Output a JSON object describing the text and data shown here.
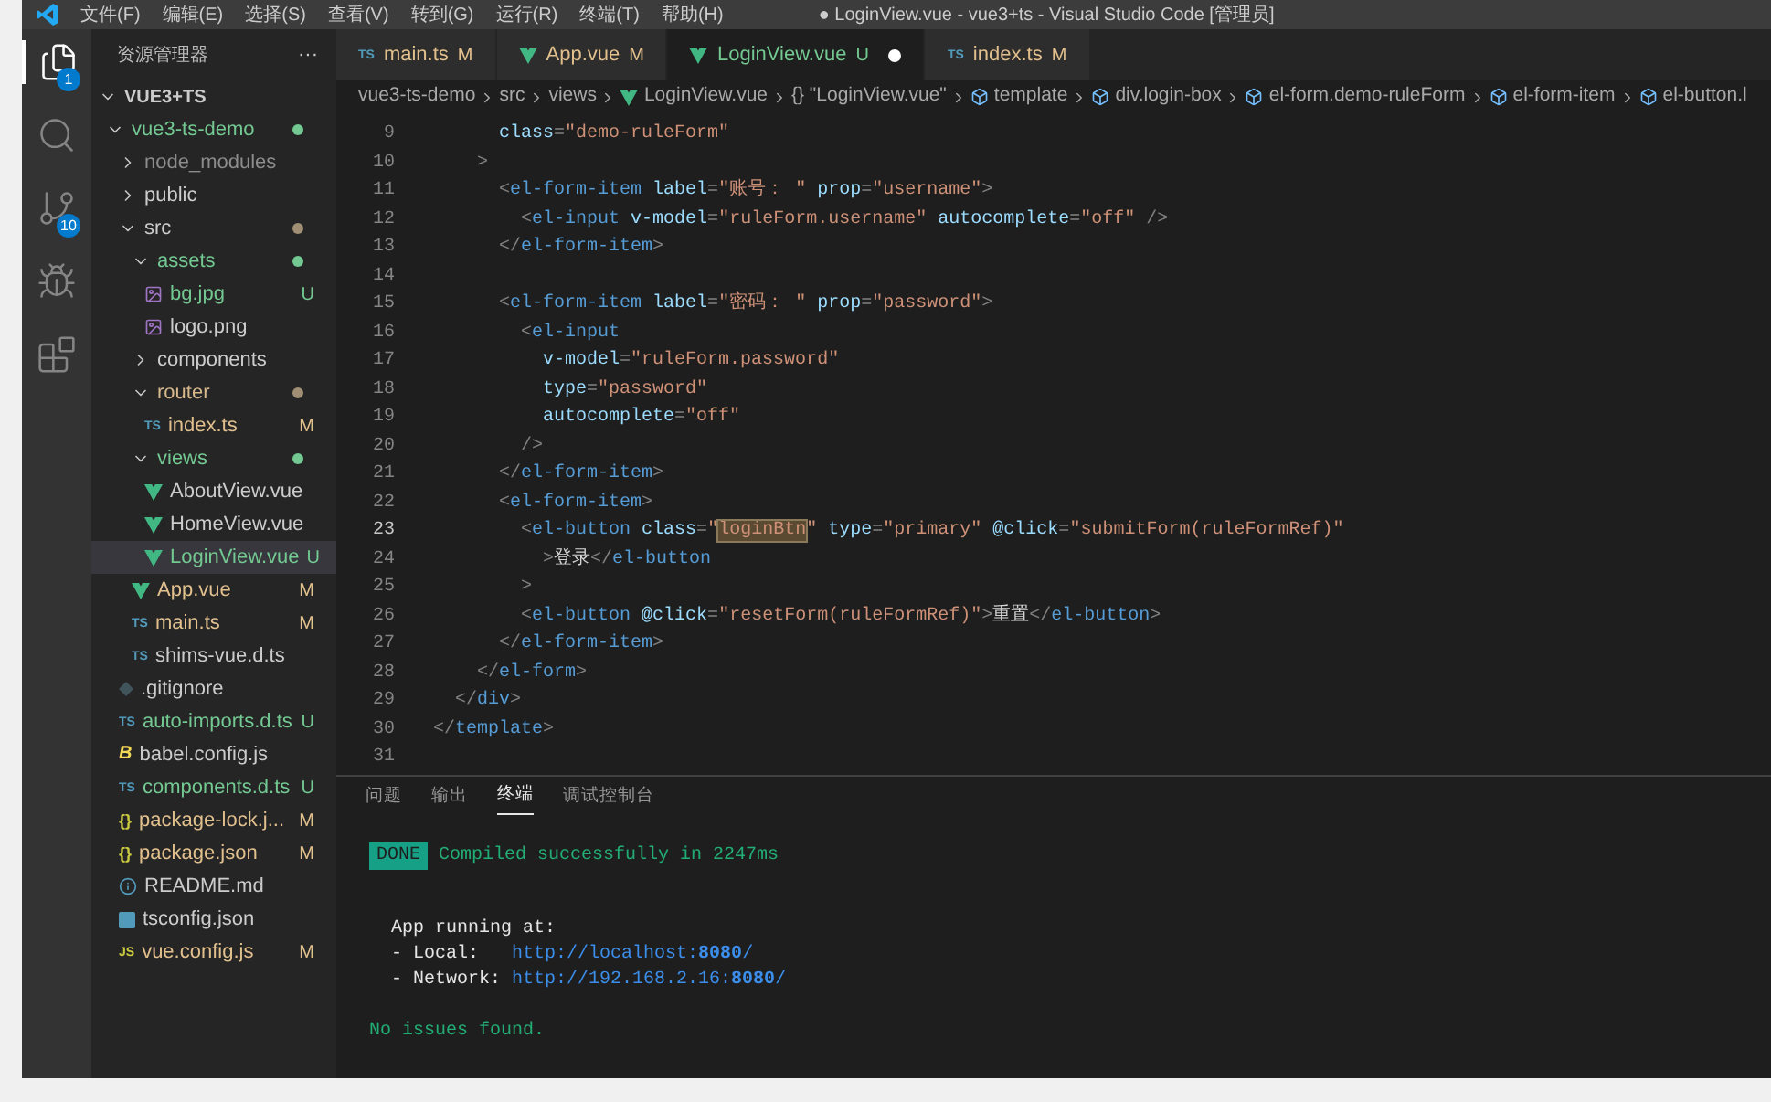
{
  "window": {
    "title": "● LoginView.vue - vue3+ts - Visual Studio Code [管理员]"
  },
  "menu": [
    "文件(F)",
    "编辑(E)",
    "选择(S)",
    "查看(V)",
    "转到(G)",
    "运行(R)",
    "终端(T)",
    "帮助(H)"
  ],
  "activity_bar": [
    {
      "kind": "explorer",
      "selected": true,
      "badge": "1"
    },
    {
      "kind": "search",
      "selected": false
    },
    {
      "kind": "source-control",
      "selected": false,
      "badge": "10"
    },
    {
      "kind": "run",
      "selected": false
    },
    {
      "kind": "extensions",
      "selected": false
    }
  ],
  "sidebar": {
    "title": "资源管理器",
    "more": "···",
    "section": {
      "name": "VUE3+TS",
      "expanded": true,
      "items": [
        {
          "name": "vue3-ts-demo",
          "kind": "folder",
          "expanded": true,
          "color": "#73c991",
          "dot": {
            "color": "#73c991"
          },
          "children": [
            {
              "name": "node_modules",
              "kind": "folder",
              "expanded": false,
              "color": "#8c8c8c"
            },
            {
              "name": "public",
              "kind": "folder",
              "expanded": false,
              "color": "#cccccc"
            },
            {
              "name": "src",
              "kind": "folder",
              "expanded": true,
              "color": "#cccccc",
              "dot": {
                "color": "#a08f73"
              },
              "children": [
                {
                  "name": "assets",
                  "kind": "folder",
                  "expanded": true,
                  "color": "#73c991",
                  "dot": {
                    "color": "#73c991"
                  },
                  "children": [
                    {
                      "name": "bg.jpg",
                      "kind": "image",
                      "color": "#73c991",
                      "badge": "U",
                      "selected": false
                    },
                    {
                      "name": "logo.png",
                      "kind": "image",
                      "color": "#cccccc",
                      "selected": false
                    }
                  ]
                },
                {
                  "name": "components",
                  "kind": "folder",
                  "expanded": false,
                  "color": "#cccccc"
                },
                {
                  "name": "router",
                  "kind": "folder",
                  "expanded": true,
                  "color": "#d7b98c",
                  "dot": {
                    "color": "#a08f73"
                  },
                  "children": [
                    {
                      "name": "index.ts",
                      "kind": "ts",
                      "icon_label": "TS",
                      "color": "#e2c08d",
                      "badge": "M",
                      "selected": false
                    }
                  ]
                },
                {
                  "name": "views",
                  "kind": "folder",
                  "expanded": true,
                  "color": "#73c991",
                  "dot": {
                    "color": "#73c991"
                  },
                  "children": [
                    {
                      "name": "AboutView.vue",
                      "kind": "vue",
                      "color": "#cccccc",
                      "selected": false
                    },
                    {
                      "name": "HomeView.vue",
                      "kind": "vue",
                      "color": "#cccccc",
                      "selected": false
                    },
                    {
                      "name": "LoginView.vue",
                      "kind": "vue",
                      "color": "#73c991",
                      "badge": "U",
                      "selected": true
                    }
                  ]
                },
                {
                  "name": "App.vue",
                  "kind": "vue",
                  "color": "#e2c08d",
                  "badge": "M",
                  "selected": false
                },
                {
                  "name": "main.ts",
                  "kind": "ts",
                  "icon_label": "TS",
                  "color": "#e2c08d",
                  "badge": "M",
                  "selected": false
                },
                {
                  "name": "shims-vue.d.ts",
                  "kind": "ts",
                  "icon_label": "TS",
                  "color": "#cccccc",
                  "selected": false
                }
              ]
            },
            {
              "name": ".gitignore",
              "kind": "git",
              "color": "#cccccc",
              "selected": false
            },
            {
              "name": "auto-imports.d.ts",
              "kind": "ts",
              "icon_label": "TS",
              "color": "#73c991",
              "badge": "U",
              "selected": false
            },
            {
              "name": "babel.config.js",
              "kind": "babel",
              "icon_label": "B",
              "color": "#cccccc",
              "selected": false
            },
            {
              "name": "components.d.ts",
              "kind": "ts",
              "icon_label": "TS",
              "color": "#73c991",
              "badge": "U",
              "selected": false
            },
            {
              "name": "package-lock.j...",
              "kind": "json",
              "icon_label": "{}",
              "color": "#e2c08d",
              "badge": "M",
              "selected": false
            },
            {
              "name": "package.json",
              "kind": "json",
              "icon_label": "{}",
              "color": "#e2c08d",
              "badge": "M",
              "selected": false
            },
            {
              "name": "README.md",
              "kind": "info",
              "color": "#cccccc",
              "selected": false
            },
            {
              "name": "tsconfig.json",
              "kind": "tsconfig",
              "color": "#cccccc",
              "selected": false
            },
            {
              "name": "vue.config.js",
              "kind": "js",
              "icon_label": "JS",
              "color": "#e2c08d",
              "badge": "M",
              "selected": false
            }
          ]
        }
      ]
    }
  },
  "tabs": [
    {
      "label": "main.ts",
      "kind": "ts",
      "icon_label": "TS",
      "color": "#e2c08d",
      "badge": "M",
      "selected": false,
      "dirty": false
    },
    {
      "label": "App.vue",
      "kind": "vue",
      "color": "#e2c08d",
      "badge": "M",
      "selected": false,
      "dirty": false
    },
    {
      "label": "LoginView.vue",
      "kind": "vue",
      "color": "#73c991",
      "badge": "U",
      "selected": true,
      "dirty": true
    },
    {
      "label": "index.ts",
      "kind": "ts",
      "icon_label": "TS",
      "color": "#e2c08d",
      "badge": "M",
      "selected": false,
      "dirty": false
    }
  ],
  "breadcrumbs": [
    {
      "text": "vue3-ts-demo",
      "kind": "folder"
    },
    {
      "text": "src",
      "kind": "folder"
    },
    {
      "text": "views",
      "kind": "folder"
    },
    {
      "text": "LoginView.vue",
      "kind": "vue"
    },
    {
      "text": "{} \"LoginView.vue\"",
      "kind": "symbol"
    },
    {
      "text": "template",
      "kind": "element"
    },
    {
      "text": "div.login-box",
      "kind": "element"
    },
    {
      "text": "el-form.demo-ruleForm",
      "kind": "element"
    },
    {
      "text": "el-form-item",
      "kind": "element"
    },
    {
      "text": "el-button.l",
      "kind": "element"
    }
  ],
  "code": [
    {
      "number": "9",
      "current": false,
      "tokens": [
        {
          "kind": "attr",
          "text": "      class"
        },
        {
          "kind": "punct",
          "text": "="
        },
        {
          "kind": "str",
          "text": "\"demo-ruleForm\""
        }
      ]
    },
    {
      "number": "10",
      "current": false,
      "tokens": [
        {
          "kind": "punct",
          "text": "    >"
        }
      ]
    },
    {
      "number": "11",
      "current": false,
      "tokens": [
        {
          "kind": "punct",
          "text": "      <"
        },
        {
          "kind": "tag",
          "text": "el-form-item"
        },
        {
          "kind": "attr",
          "text": " label"
        },
        {
          "kind": "punct",
          "text": "="
        },
        {
          "kind": "str",
          "text": "\"账号： \""
        },
        {
          "kind": "attr",
          "text": " prop"
        },
        {
          "kind": "punct",
          "text": "="
        },
        {
          "kind": "str",
          "text": "\"username\""
        },
        {
          "kind": "punct",
          "text": ">"
        }
      ]
    },
    {
      "number": "12",
      "current": false,
      "tokens": [
        {
          "kind": "punct",
          "text": "        <"
        },
        {
          "kind": "tag",
          "text": "el-input"
        },
        {
          "kind": "attr",
          "text": " v-model"
        },
        {
          "kind": "punct",
          "text": "="
        },
        {
          "kind": "str",
          "text": "\"ruleForm.username\""
        },
        {
          "kind": "attr",
          "text": " autocomplete"
        },
        {
          "kind": "punct",
          "text": "="
        },
        {
          "kind": "str",
          "text": "\"off\""
        },
        {
          "kind": "punct",
          "text": " />"
        }
      ]
    },
    {
      "number": "13",
      "current": false,
      "tokens": [
        {
          "kind": "punct",
          "text": "      </"
        },
        {
          "kind": "tag",
          "text": "el-form-item"
        },
        {
          "kind": "punct",
          "text": ">"
        }
      ]
    },
    {
      "number": "14",
      "current": false
    },
    {
      "number": "15",
      "current": false,
      "tokens": [
        {
          "kind": "punct",
          "text": "      <"
        },
        {
          "kind": "tag",
          "text": "el-form-item"
        },
        {
          "kind": "attr",
          "text": " label"
        },
        {
          "kind": "punct",
          "text": "="
        },
        {
          "kind": "str",
          "text": "\"密码： \""
        },
        {
          "kind": "attr",
          "text": " prop"
        },
        {
          "kind": "punct",
          "text": "="
        },
        {
          "kind": "str",
          "text": "\"password\""
        },
        {
          "kind": "punct",
          "text": ">"
        }
      ]
    },
    {
      "number": "16",
      "current": false,
      "tokens": [
        {
          "kind": "punct",
          "text": "        <"
        },
        {
          "kind": "tag",
          "text": "el-input"
        }
      ]
    },
    {
      "number": "17",
      "current": false,
      "tokens": [
        {
          "kind": "attr",
          "text": "          v-model"
        },
        {
          "kind": "punct",
          "text": "="
        },
        {
          "kind": "str",
          "text": "\"ruleForm.password\""
        }
      ]
    },
    {
      "number": "18",
      "current": false,
      "tokens": [
        {
          "kind": "attr",
          "text": "          type"
        },
        {
          "kind": "punct",
          "text": "="
        },
        {
          "kind": "str",
          "text": "\"password\""
        }
      ]
    },
    {
      "number": "19",
      "current": false,
      "tokens": [
        {
          "kind": "attr",
          "text": "          autocomplete"
        },
        {
          "kind": "punct",
          "text": "="
        },
        {
          "kind": "str",
          "text": "\"off\""
        }
      ]
    },
    {
      "number": "20",
      "current": false,
      "tokens": [
        {
          "kind": "punct",
          "text": "        />"
        }
      ]
    },
    {
      "number": "21",
      "current": false,
      "tokens": [
        {
          "kind": "punct",
          "text": "      </"
        },
        {
          "kind": "tag",
          "text": "el-form-item"
        },
        {
          "kind": "punct",
          "text": ">"
        }
      ]
    },
    {
      "number": "22",
      "current": false,
      "tokens": [
        {
          "kind": "punct",
          "text": "      <"
        },
        {
          "kind": "tag",
          "text": "el-form-item"
        },
        {
          "kind": "punct",
          "text": ">"
        }
      ]
    },
    {
      "number": "23",
      "current": true,
      "tokens": [
        {
          "kind": "punct",
          "text": "        <"
        },
        {
          "kind": "tag",
          "text": "el-button"
        },
        {
          "kind": "attr",
          "text": " class"
        },
        {
          "kind": "punct",
          "text": "="
        },
        {
          "kind": "str",
          "text": "\""
        },
        {
          "kind": "sel",
          "text": "loginBtn"
        },
        {
          "kind": "str",
          "text": "\""
        },
        {
          "kind": "attr",
          "text": " type"
        },
        {
          "kind": "punct",
          "text": "="
        },
        {
          "kind": "str",
          "text": "\"primary\""
        },
        {
          "kind": "attr",
          "text": " @click"
        },
        {
          "kind": "punct",
          "text": "="
        },
        {
          "kind": "str",
          "text": "\"submitForm(ruleFormRef)\""
        }
      ]
    },
    {
      "number": "24",
      "current": false,
      "tokens": [
        {
          "kind": "punct",
          "text": "          >"
        },
        {
          "kind": "text",
          "text": "登录"
        },
        {
          "kind": "punct",
          "text": "</"
        },
        {
          "kind": "tag",
          "text": "el-button"
        }
      ]
    },
    {
      "number": "25",
      "current": false,
      "tokens": [
        {
          "kind": "punct",
          "text": "        >"
        }
      ]
    },
    {
      "number": "26",
      "current": false,
      "tokens": [
        {
          "kind": "punct",
          "text": "        <"
        },
        {
          "kind": "tag",
          "text": "el-button"
        },
        {
          "kind": "attr",
          "text": " @click"
        },
        {
          "kind": "punct",
          "text": "="
        },
        {
          "kind": "str",
          "text": "\"resetForm(ruleFormRef)\""
        },
        {
          "kind": "punct",
          "text": ">"
        },
        {
          "kind": "text",
          "text": "重置"
        },
        {
          "kind": "punct",
          "text": "</"
        },
        {
          "kind": "tag",
          "text": "el-button"
        },
        {
          "kind": "punct",
          "text": ">"
        }
      ]
    },
    {
      "number": "27",
      "current": false,
      "tokens": [
        {
          "kind": "punct",
          "text": "      </"
        },
        {
          "kind": "tag",
          "text": "el-form-item"
        },
        {
          "kind": "punct",
          "text": ">"
        }
      ]
    },
    {
      "number": "28",
      "current": false,
      "tokens": [
        {
          "kind": "punct",
          "text": "    </"
        },
        {
          "kind": "tag",
          "text": "el-form"
        },
        {
          "kind": "punct",
          "text": ">"
        }
      ]
    },
    {
      "number": "29",
      "current": false,
      "tokens": [
        {
          "kind": "punct",
          "text": "  </"
        },
        {
          "kind": "tag",
          "text": "div"
        },
        {
          "kind": "punct",
          "text": ">"
        }
      ]
    },
    {
      "number": "30",
      "current": false,
      "tokens": [
        {
          "kind": "punct",
          "text": "</"
        },
        {
          "kind": "tag",
          "text": "template"
        },
        {
          "kind": "punct",
          "text": ">"
        }
      ]
    },
    {
      "number": "31",
      "current": false
    }
  ],
  "panel": {
    "tabs": [
      {
        "label": "问题",
        "selected": false
      },
      {
        "label": "输出",
        "selected": false
      },
      {
        "label": "终端",
        "selected": true
      },
      {
        "label": "调试控制台",
        "selected": false
      }
    ],
    "terminal": {
      "status": {
        "badge": "DONE",
        "message": "Compiled successfully in 2247ms"
      },
      "heading": "App running at:",
      "entries": [
        {
          "label": "- Local:   ",
          "url": "http://localhost:**8080**/"
        },
        {
          "label": "- Network: ",
          "url": "http://192.168.2.16:**8080**/"
        }
      ],
      "result": "No issues found."
    }
  }
}
